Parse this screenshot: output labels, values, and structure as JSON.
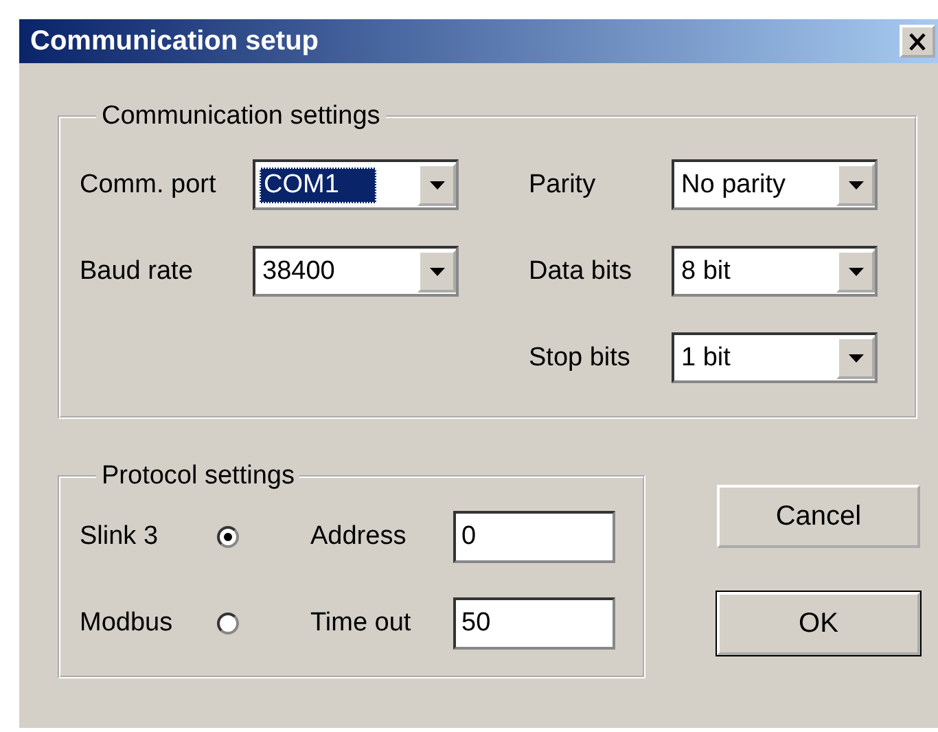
{
  "window": {
    "title": "Communication setup"
  },
  "communication_settings": {
    "title": "Communication settings",
    "left_fields": [
      {
        "label": "Comm. port",
        "value": "COM1",
        "focused": true
      },
      {
        "label": "Baud rate",
        "value": "38400",
        "focused": false
      }
    ],
    "right_fields": [
      {
        "label": "Parity",
        "value": "No parity",
        "focused": false
      },
      {
        "label": "Data bits",
        "value": "8 bit",
        "focused": false
      },
      {
        "label": "Stop bits",
        "value": "1 bit",
        "focused": false
      }
    ]
  },
  "protocol_settings": {
    "title": "Protocol settings",
    "protocols": [
      {
        "label": "Slink 3",
        "selected": true
      },
      {
        "label": "Modbus",
        "selected": false
      }
    ],
    "fields": [
      {
        "label": "Address",
        "value": "0"
      },
      {
        "label": "Time out",
        "value": "50"
      }
    ]
  },
  "buttons": [
    {
      "label": "Cancel",
      "default": false
    },
    {
      "label": "OK",
      "default": true
    }
  ]
}
